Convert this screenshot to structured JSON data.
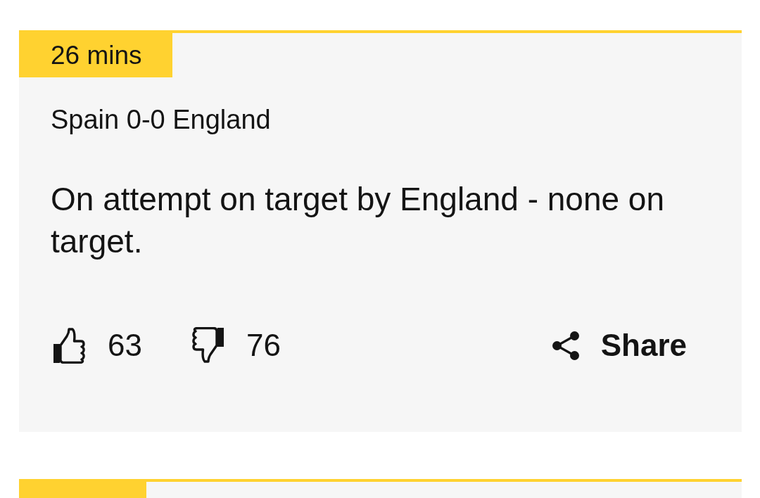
{
  "entries": [
    {
      "kind": "full",
      "time": "26 mins",
      "title": "Spain 0-0 England",
      "body": "On attempt on target by England - none on target.",
      "reactions": [
        {
          "kind": "like",
          "count": "63"
        },
        {
          "kind": "dislike",
          "count": "76"
        }
      ],
      "share": "Share"
    },
    {
      "kind": "cut_off"
    }
  ]
}
